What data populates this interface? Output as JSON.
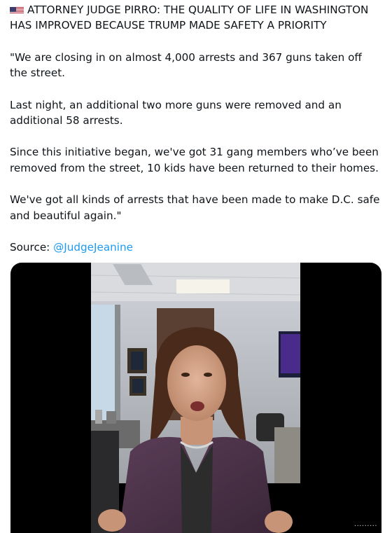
{
  "tweet": {
    "headline": "ATTORNEY JUDGE PIRRO: THE QUALITY OF LIFE IN WASHINGTON HAS IMPROVED BECAUSE TRUMP MADE SAFETY A PRIORITY",
    "paragraphs": [
      "\"We are closing in on almost 4,000 arrests and 367 guns taken off the street.",
      "Last night, an additional two more guns were removed and an additional 58 arrests.",
      "Since this initiative began, we've got 31 gang members who’ve been removed from the street, 10 kids have been returned to their homes.",
      "We've got all kinds of arrests that have been made to make D.C. safe and beautiful again.\""
    ],
    "source_label": "Source: ",
    "source_handle": "@JudgeJeanine"
  },
  "media": {
    "type": "video",
    "watermark": "·········"
  },
  "icons": {
    "flag": "us-flag-icon"
  }
}
